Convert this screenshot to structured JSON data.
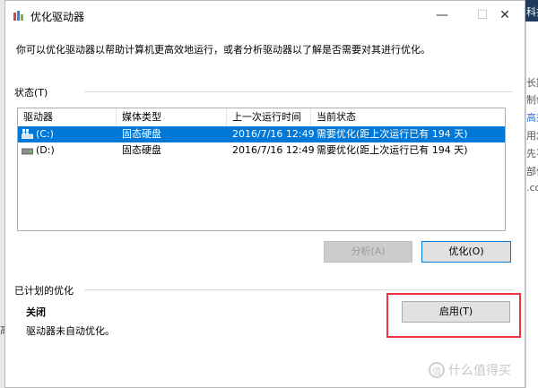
{
  "background": {
    "top_text": "科技",
    "left_text": "高",
    "right_fragments": [
      "长期安",
      "制创对",
      "高须",
      "用您对",
      "先不",
      "部件",
      ".co"
    ]
  },
  "window": {
    "title": "优化驱动器",
    "controls": {
      "minimize": "—",
      "maximize": "☐",
      "close": "✕"
    },
    "description": "你可以优化驱动器以帮助计算机更高效地运行，或者分析驱动器以了解是否需要对其进行优化。"
  },
  "status_section": {
    "label": "状态(T)",
    "columns": [
      "驱动器",
      "媒体类型",
      "上一次运行时间",
      "当前状态"
    ],
    "rows": [
      {
        "drive": "(C:)",
        "media": "固态硬盘",
        "last_run": "2016/7/16 12:49",
        "status": "需要优化(距上次运行已有 194 天)",
        "selected": true
      },
      {
        "drive": "(D:)",
        "media": "固态硬盘",
        "last_run": "2016/7/16 12:49",
        "status": "需要优化(距上次运行已有 194 天)",
        "selected": false
      }
    ],
    "analyze_label": "分析(A)",
    "optimize_label": "优化(O)"
  },
  "schedule_section": {
    "label": "已计划的优化",
    "status": "关闭",
    "note": "驱动器未自动优化。",
    "enable_label": "启用(T)"
  },
  "watermark": {
    "text": "什么值得买",
    "glyph": "值"
  },
  "colors": {
    "selection": "#0078d7",
    "highlight": "#e8333a"
  }
}
